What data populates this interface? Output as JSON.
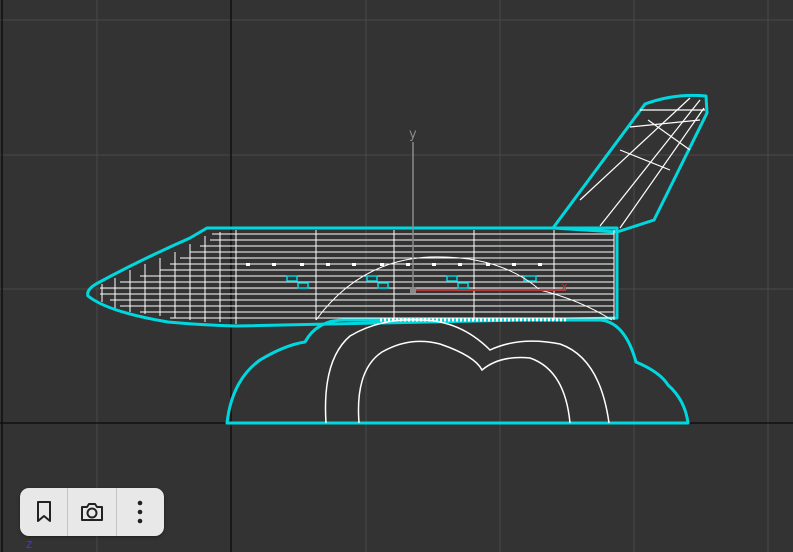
{
  "viewport": {
    "background": "#333333",
    "grid_color": "#4a4a4a",
    "origin_axis_color": "#0a0a0a",
    "selection_color": "#00d8e0",
    "wireframe_color": "#ffffff",
    "model": "space-shuttle-on-cloud"
  },
  "gizmo": {
    "y_label": "y",
    "x_label": "x",
    "y_color": "#8a8a8a",
    "x_color": "#b03a3a"
  },
  "corner_axis": {
    "label": "z",
    "color": "#3a3ad8"
  },
  "toolbar": {
    "buttons": [
      {
        "icon": "bookmark-icon"
      },
      {
        "icon": "camera-icon"
      },
      {
        "icon": "more-vertical-icon"
      }
    ]
  }
}
